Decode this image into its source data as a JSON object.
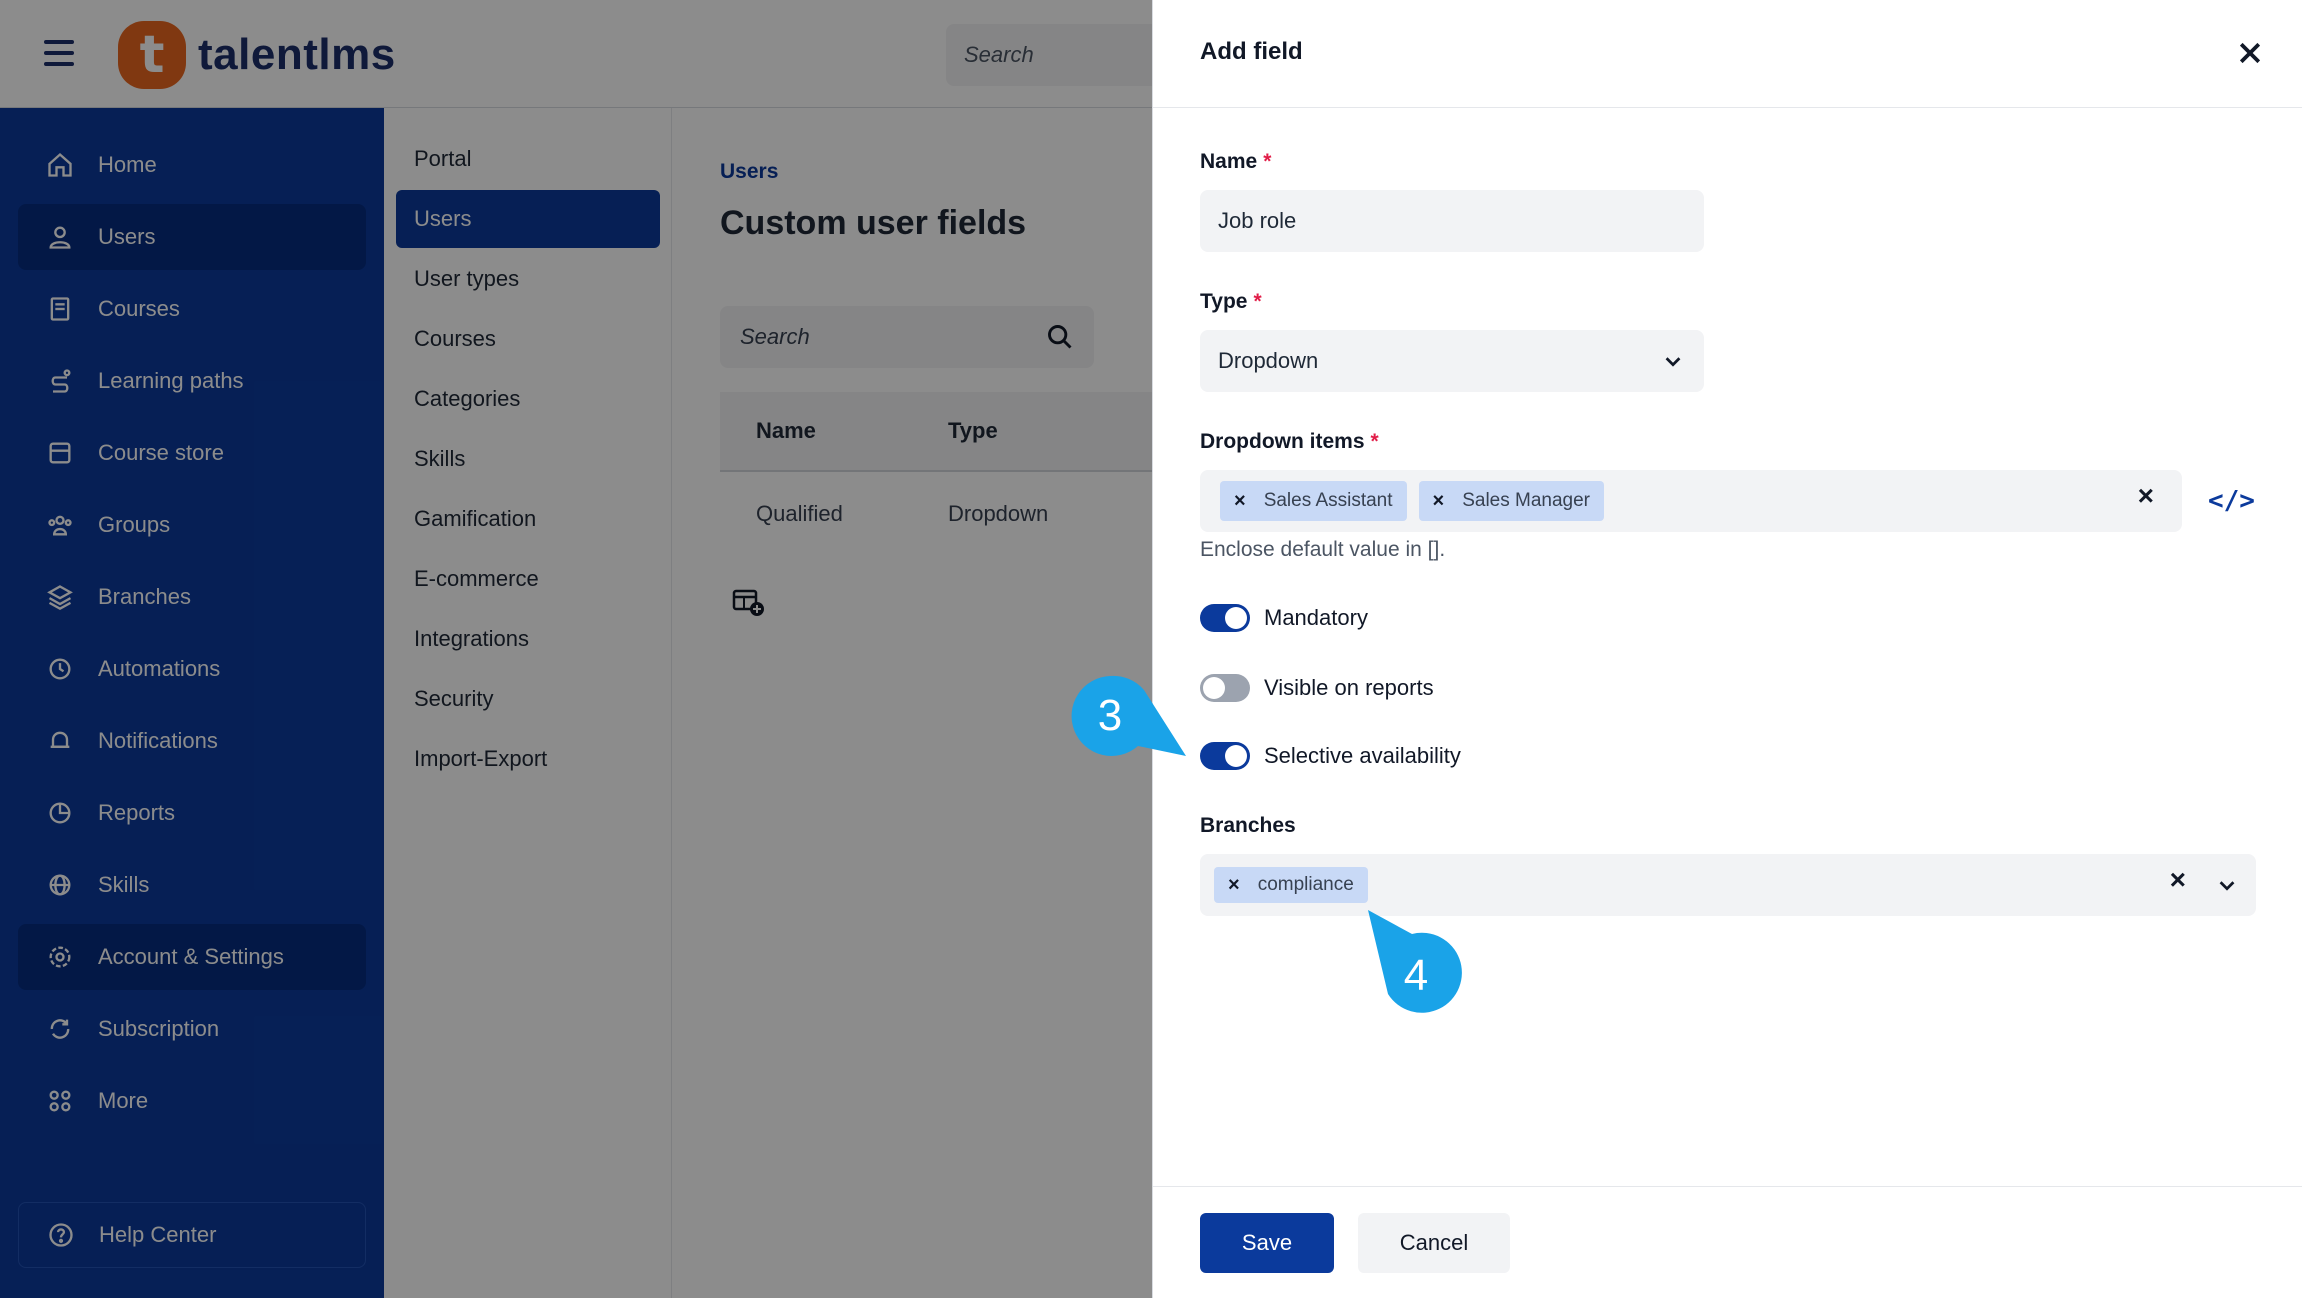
{
  "app": {
    "logo_letter": "t",
    "logo_text": "talentlms",
    "top_search_placeholder": "Search"
  },
  "sidebar": {
    "items": [
      {
        "label": "Home",
        "icon": "home-icon"
      },
      {
        "label": "Users",
        "icon": "user-icon",
        "active": true
      },
      {
        "label": "Courses",
        "icon": "book-icon"
      },
      {
        "label": "Learning paths",
        "icon": "path-icon"
      },
      {
        "label": "Course store",
        "icon": "store-icon"
      },
      {
        "label": "Groups",
        "icon": "groups-icon"
      },
      {
        "label": "Branches",
        "icon": "layers-icon"
      },
      {
        "label": "Automations",
        "icon": "automation-icon"
      },
      {
        "label": "Notifications",
        "icon": "bell-icon"
      },
      {
        "label": "Reports",
        "icon": "pie-chart-icon"
      },
      {
        "label": "Skills",
        "icon": "globe-icon"
      },
      {
        "label": "Account & Settings",
        "icon": "gear-icon",
        "active": true
      },
      {
        "label": "Subscription",
        "icon": "refresh-icon"
      },
      {
        "label": "More",
        "icon": "grid-icon"
      }
    ],
    "help": "Help Center"
  },
  "submenu": {
    "items": [
      "Portal",
      "Users",
      "User types",
      "Courses",
      "Categories",
      "Skills",
      "Gamification",
      "E-commerce",
      "Integrations",
      "Security",
      "Import-Export"
    ],
    "active": "Users"
  },
  "main": {
    "breadcrumb": "Users",
    "title": "Custom user fields",
    "search_placeholder": "Search",
    "columns": [
      "Name",
      "Type"
    ],
    "rows": [
      {
        "name": "Qualified",
        "type": "Dropdown"
      }
    ]
  },
  "drawer": {
    "title": "Add field",
    "name_label": "Name",
    "name_value": "Job role",
    "type_label": "Type",
    "type_value": "Dropdown",
    "items_label": "Dropdown items",
    "items": [
      "Sales Assistant",
      "Sales Manager"
    ],
    "items_hint": "Enclose default value in [].",
    "toggles": [
      {
        "label": "Mandatory",
        "on": true
      },
      {
        "label": "Visible on reports",
        "on": false
      },
      {
        "label": "Selective availability",
        "on": true
      }
    ],
    "branches_label": "Branches",
    "branches": [
      "compliance"
    ],
    "save": "Save",
    "cancel": "Cancel",
    "required_mark": "*",
    "chip_remove": "×",
    "code_toggle": "</>"
  },
  "callouts": {
    "step3": "3",
    "step4": "4",
    "color": "#1aa3e8"
  },
  "colors": {
    "brand_blue": "#0b3a9c",
    "logo_orange": "#e9671f"
  }
}
